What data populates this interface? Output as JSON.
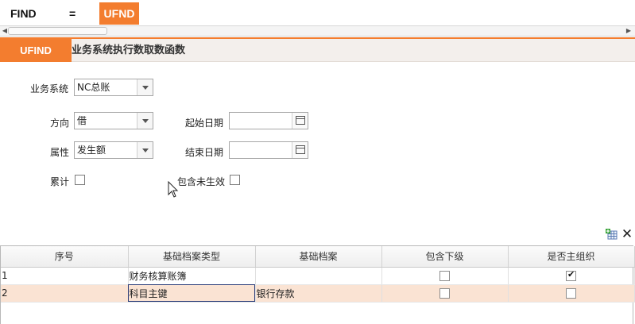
{
  "formula": {
    "left": "FIND",
    "eq": "=",
    "right": "UFND"
  },
  "title": {
    "badge": "UFIND",
    "text": "业务系统执行数取数函数"
  },
  "form": {
    "business_system": {
      "label": "业务系统",
      "value": "NC总账"
    },
    "direction": {
      "label": "方向",
      "value": "借"
    },
    "attribute": {
      "label": "属性",
      "value": "发生额"
    },
    "cumulative": {
      "label": "累计",
      "checked": false
    },
    "start_date": {
      "label": "起始日期",
      "value": ""
    },
    "end_date": {
      "label": "结束日期",
      "value": ""
    },
    "include_unvalidated": {
      "label": "包含未生效",
      "checked": false
    }
  },
  "grid": {
    "columns": [
      "序号",
      "基础档案类型",
      "基础档案",
      "包含下级",
      "是否主组织"
    ],
    "rows": [
      {
        "index": "1",
        "type": "财务核算账簿",
        "archive": "",
        "include_sub": false,
        "is_main_org": true
      },
      {
        "index": "2",
        "type": "科目主键",
        "archive": "银行存款",
        "include_sub": false,
        "is_main_org": false
      }
    ]
  },
  "colors": {
    "accent": "#f37d2f",
    "row_highlight": "#fae3d3",
    "title_bg": "#f3efec"
  }
}
